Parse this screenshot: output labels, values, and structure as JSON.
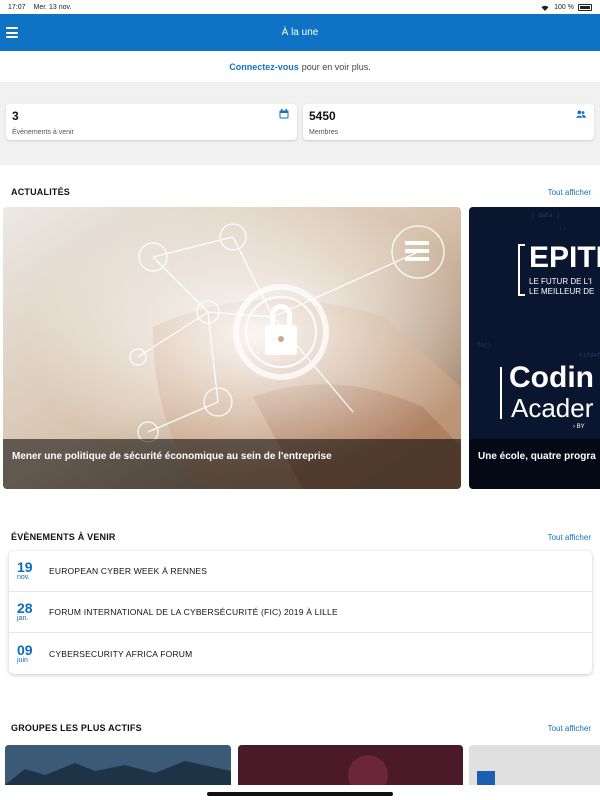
{
  "status_bar": {
    "time": "17:07",
    "date": "Mer. 13 nov.",
    "battery": "100 %"
  },
  "nav": {
    "title": "À la une"
  },
  "login_banner": {
    "link": "Connectez-vous",
    "text": "pour en voir plus."
  },
  "stats": [
    {
      "value": "3",
      "label": "Évènements à venir",
      "icon": "calendar-icon"
    },
    {
      "value": "5450",
      "label": "Membres",
      "icon": "members-icon"
    }
  ],
  "news": {
    "title": "ACTUALITÉS",
    "link": "Tout afficher",
    "items": [
      {
        "caption": "Mener une politique de sécurité économique au sein de l'entreprise"
      },
      {
        "caption": "Une école, quatre progra",
        "brand_top": "EPITE",
        "brand_sub1": "LE FUTUR DE L'I",
        "brand_sub2": "LE MEILLEUR DE",
        "brand_main1": "Codin",
        "brand_main2": "Acader",
        "brand_by": "› BY"
      }
    ]
  },
  "events": {
    "title": "ÉVÈNEMENTS À VENIR",
    "link": "Tout afficher",
    "items": [
      {
        "day": "19",
        "month": "nov.",
        "title": "EUROPEAN CYBER WEEK À RENNES"
      },
      {
        "day": "28",
        "month": "jan.",
        "title": "FORUM INTERNATIONAL DE LA CYBERSÉCURITÉ (FIC) 2019 À LILLE"
      },
      {
        "day": "09",
        "month": "juin",
        "title": "CYBERSECURITY AFRICA FORUM"
      }
    ]
  },
  "groups": {
    "title": "GROUPES LES PLUS ACTIFS",
    "link": "Tout afficher"
  },
  "colors": {
    "brand": "#0e72c5",
    "accent_text": "#1572c4"
  }
}
